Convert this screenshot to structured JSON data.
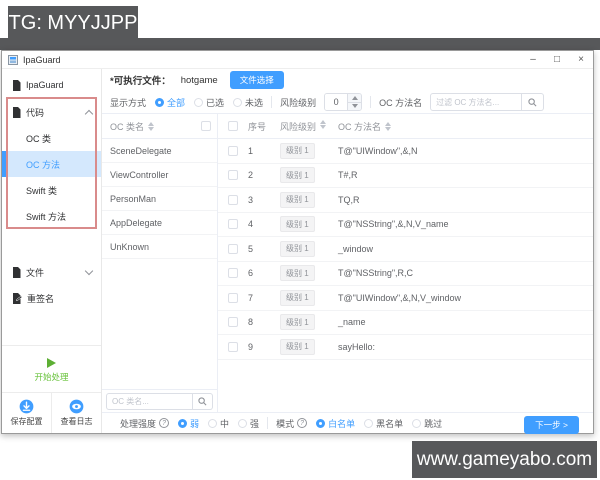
{
  "overlays": {
    "top_banner": "TG: MYYJJPP",
    "bottom_banner": "www.gameyabo.com"
  },
  "window": {
    "title": "IpaGuard",
    "controls": {
      "minimize": "–",
      "maximize": "□",
      "close": "×"
    }
  },
  "sidebar": {
    "app_item": "IpaGuard",
    "code_group": "代码",
    "oc_class": "OC 类",
    "oc_method": "OC 方法",
    "swift_class": "Swift 类",
    "swift_method": "Swift 方法",
    "file_group": "文件",
    "resign": "重签名",
    "start_button": "开始处理",
    "save_config": "保存配置",
    "view_logs": "查看日志"
  },
  "toolbar": {
    "exec_label": "*可执行文件：",
    "exec_value": "hotgame",
    "file_select_button": "文件选择",
    "display_mode_label": "显示方式",
    "display_options": [
      "全部",
      "已选",
      "未选"
    ],
    "display_selected": "全部",
    "risk_label": "风险级别",
    "risk_value": "0",
    "method_label": "OC 方法名",
    "method_filter_placeholder": "过滤 OC 方法名..."
  },
  "class_panel": {
    "header": "OC 类名",
    "classes": [
      "SceneDelegate",
      "ViewController",
      "PersonMan",
      "AppDelegate",
      "UnKnown"
    ],
    "search_placeholder": "OC 类名..."
  },
  "table": {
    "headers": {
      "index": "序号",
      "risk": "风险级别",
      "method": "OC 方法名"
    },
    "rows": [
      {
        "index": "1",
        "risk": "级别 1",
        "method": "T@\"UIWindow\",&,N"
      },
      {
        "index": "2",
        "risk": "级别 1",
        "method": "T#,R"
      },
      {
        "index": "3",
        "risk": "级别 1",
        "method": "TQ,R"
      },
      {
        "index": "4",
        "risk": "级别 1",
        "method": "T@\"NSString\",&,N,V_name"
      },
      {
        "index": "5",
        "risk": "级别 1",
        "method": "_window"
      },
      {
        "index": "6",
        "risk": "级别 1",
        "method": "T@\"NSString\",R,C"
      },
      {
        "index": "7",
        "risk": "级别 1",
        "method": "T@\"UIWindow\",&,N,V_window"
      },
      {
        "index": "8",
        "risk": "级别 1",
        "method": "_name"
      },
      {
        "index": "9",
        "risk": "级别 1",
        "method": "sayHello:"
      }
    ]
  },
  "footer": {
    "strength_label": "处理强度",
    "strength_options": [
      "弱",
      "中",
      "强"
    ],
    "strength_selected": "弱",
    "mode_label": "模式",
    "mode_options": [
      "白名单",
      "黑名单",
      "跳过"
    ],
    "mode_selected": "白名单",
    "next_button": "下一步 >"
  },
  "colors": {
    "accent": "#409eff",
    "success": "#67c23a",
    "banner": "#57585a",
    "selected_item_bg": "#d4e8fd",
    "highlight_border": "#d98b8b",
    "badge_bg": "#f4f4f5",
    "badge_text": "#909399"
  }
}
